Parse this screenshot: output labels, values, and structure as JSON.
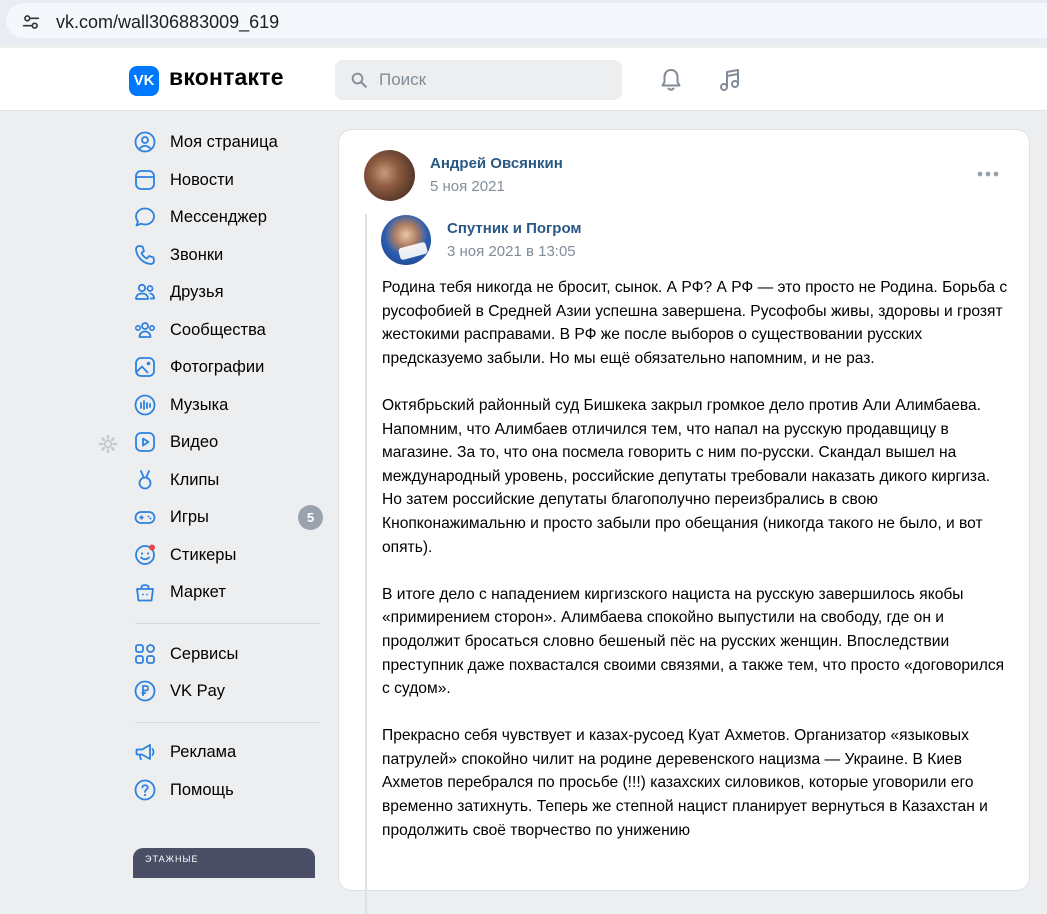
{
  "browser": {
    "url": "vk.com/wall306883009_619"
  },
  "header": {
    "logo_text": "вконтакте",
    "logo_mark": "VK",
    "search_placeholder": "Поиск"
  },
  "sidebar": {
    "items": [
      {
        "label": "Моя страница",
        "icon": "profile-icon"
      },
      {
        "label": "Новости",
        "icon": "news-icon"
      },
      {
        "label": "Мессенджер",
        "icon": "messenger-icon"
      },
      {
        "label": "Звонки",
        "icon": "phone-icon"
      },
      {
        "label": "Друзья",
        "icon": "friends-icon"
      },
      {
        "label": "Сообщества",
        "icon": "communities-icon"
      },
      {
        "label": "Фотографии",
        "icon": "photos-icon"
      },
      {
        "label": "Музыка",
        "icon": "music-icon"
      },
      {
        "label": "Видео",
        "icon": "video-icon"
      },
      {
        "label": "Клипы",
        "icon": "clips-icon"
      },
      {
        "label": "Игры",
        "icon": "games-icon",
        "badge": "5"
      },
      {
        "label": "Стикеры",
        "icon": "stickers-icon"
      },
      {
        "label": "Маркет",
        "icon": "market-icon"
      },
      {
        "label": "Сервисы",
        "icon": "services-icon"
      },
      {
        "label": "VK Pay",
        "icon": "vkpay-icon"
      },
      {
        "label": "Реклама",
        "icon": "ads-icon"
      },
      {
        "label": "Помощь",
        "icon": "help-icon"
      }
    ],
    "promo_text": "ЭТАЖНЫЕ"
  },
  "post": {
    "author_name": "Андрей Овсянкин",
    "author_date": "5 ноя 2021",
    "repost": {
      "group_name": "Спутник и Погром",
      "group_date": "3 ноя 2021 в 13:05",
      "paragraphs": [
        "Родина тебя никогда не бросит, сынок. А РФ? А РФ — это просто не Родина. Борьба с русофобией в Средней Азии успешна завершена. Русофобы живы, здоровы и грозят жестокими расправами. В РФ же после выборов о существовании русских предсказуемо забыли. Но мы ещё обязательно напомним, и не раз.",
        "Октябрьский районный суд Бишкека закрыл громкое дело против Али Алимбаева. Напомним, что Алимбаев отличился тем, что напал на русскую продавщицу в магазине. За то, что она посмела говорить с ним по-русски. Скандал вышел на международный уровень, российские депутаты требовали наказать дикого киргиза. Но затем российские депутаты благополучно переизбрались в свою Кнопконажимальню и просто забыли про обещания (никогда такого не было, и вот опять).",
        "В итоге дело с нападением киргизского нациста на русскую завершилось якобы «примирением сторон». Алимбаева спокойно выпустили на свободу, где он и продолжит бросаться словно бешеный пёс на русских женщин. Впоследствии преступник даже похвастался своими связями, а также тем, что просто «договорился с судом».",
        "Прекрасно себя чувствует и казах-русоед Куат Ахметов. Организатор «языковых патрулей» спокойно чилит на родине деревенского нацизма — Украине. В Киев Ахметов перебрался по просьбе (!!!) казахских силовиков, которые уговорили его временно затихнуть. Теперь же степной нацист планирует вернуться в Казахстан и продолжить своё творчество по унижению"
      ]
    }
  }
}
